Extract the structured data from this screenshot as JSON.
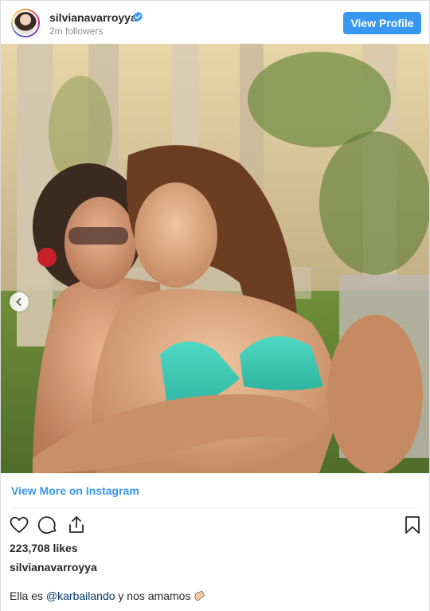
{
  "header": {
    "username": "silvianavarroyya",
    "followers": "2m followers",
    "view_profile_label": "View Profile"
  },
  "post": {
    "view_more_label": "View More on Instagram",
    "likes": "223,708 likes",
    "owner": "silvianavarroyya",
    "caption_prefix": "Ella es ",
    "caption_mention": "@karbailando",
    "caption_suffix": " y nos amamos",
    "caption_emoji": "hand-wave-emoji"
  },
  "icons": {
    "like": "heart-icon",
    "comment": "comment-icon",
    "share": "share-icon",
    "save": "bookmark-icon",
    "verified": "verified-badge-icon",
    "carousel_prev": "chevron-left-icon"
  },
  "colors": {
    "accent": "#3897f0",
    "verified": "#3897f0",
    "mention": "#003569",
    "secondary_text": "#8e8e8e"
  }
}
